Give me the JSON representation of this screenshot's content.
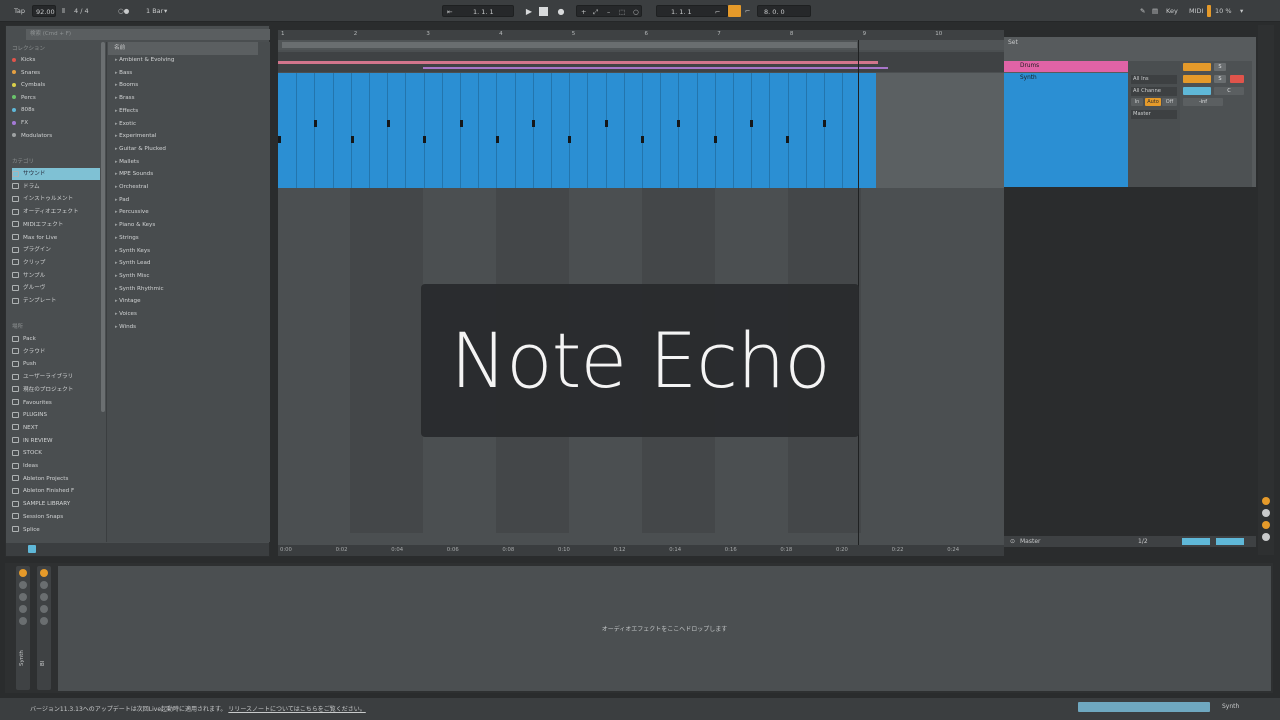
{
  "transport": {
    "tap": "Tap",
    "tempo": "92.00",
    "signature": "4 / 4",
    "quantize": "1 Bar",
    "position": "1.  1.  1",
    "loop_start": "1.  1.  1",
    "loop_length": "8.  0.  0",
    "key": "Key",
    "midi": "MIDI",
    "cpu": "10 %"
  },
  "browser": {
    "search_placeholder": "検索 (Cmd + F)",
    "collections_header": "コレクション",
    "collections": [
      {
        "label": "Kicks",
        "color": "#e0544b"
      },
      {
        "label": "Snares",
        "color": "#e5a042"
      },
      {
        "label": "Cymbals",
        "color": "#d9cf4a"
      },
      {
        "label": "Percs",
        "color": "#6ac46b"
      },
      {
        "label": "808s",
        "color": "#5fb8d8"
      },
      {
        "label": "FX",
        "color": "#a479d6"
      },
      {
        "label": "Modulators",
        "color": "#9ea2a3"
      }
    ],
    "categories_header": "カテゴリ",
    "categories": [
      "サウンド",
      "ドラム",
      "インストゥルメント",
      "オーディオエフェクト",
      "MIDIエフェクト",
      "Max for Live",
      "プラグイン",
      "クリップ",
      "サンプル",
      "グルーヴ",
      "テンプレート"
    ],
    "places_header": "場所",
    "places": [
      "Pack",
      "クラウド",
      "Push",
      "ユーザーライブラリ",
      "現在のプロジェクト",
      "Favourites",
      "PLUGINS",
      "NEXT",
      "IN REVIEW",
      "STOCK",
      "Ideas",
      "Ableton Projects",
      "Ableton Finished F",
      "SAMPLE LIBRARY",
      "Session Snaps",
      "Splice"
    ],
    "list_header": "名前",
    "list": [
      "Ambient & Evolving",
      "Bass",
      "Booms",
      "Brass",
      "Effects",
      "Exotic",
      "Experimental",
      "Guitar & Plucked",
      "Mallets",
      "MPE Sounds",
      "Orchestral",
      "Pad",
      "Percussive",
      "Piano & Keys",
      "Strings",
      "Synth Keys",
      "Synth Lead",
      "Synth Misc",
      "Synth Rhythmic",
      "Vintage",
      "Voices",
      "Winds"
    ]
  },
  "arrangement": {
    "bars": [
      "1",
      "2",
      "3",
      "4",
      "5",
      "6",
      "7",
      "8",
      "9",
      "10"
    ],
    "times": [
      "0:00",
      "0:02",
      "0:04",
      "0:06",
      "0:08",
      "0:10",
      "0:12",
      "0:14",
      "0:16",
      "0:18",
      "0:20",
      "0:22",
      "0:24"
    ]
  },
  "mixer": {
    "set_label": "Set",
    "tracks": [
      {
        "name": "Drums",
        "color": "#e063a6"
      },
      {
        "name": "Synth",
        "color": "#2b8fd3"
      }
    ],
    "io": [
      "All Ins",
      "All Channe",
      "In",
      "Auto",
      "Off",
      "Master"
    ],
    "solo": "S",
    "center": "C",
    "volume": "-inf",
    "master_name": "Master",
    "master_io": "1/2"
  },
  "device_view": {
    "strips": [
      "Synth",
      "Bl"
    ],
    "drop_text": "オーディオエフェクトをここへドロップします"
  },
  "status": {
    "message": "バージョン11.3.13へのアップデートは次回Live起動時に適用されます。",
    "link": "リリースノートについてはこちらをご覧ください。",
    "track": "Synth"
  },
  "overlay": {
    "title": "Note Echo"
  },
  "colors": {
    "accent_orange": "#e59a2a",
    "clip_blue": "#2b8fd3",
    "drums_pink": "#e063a6"
  }
}
